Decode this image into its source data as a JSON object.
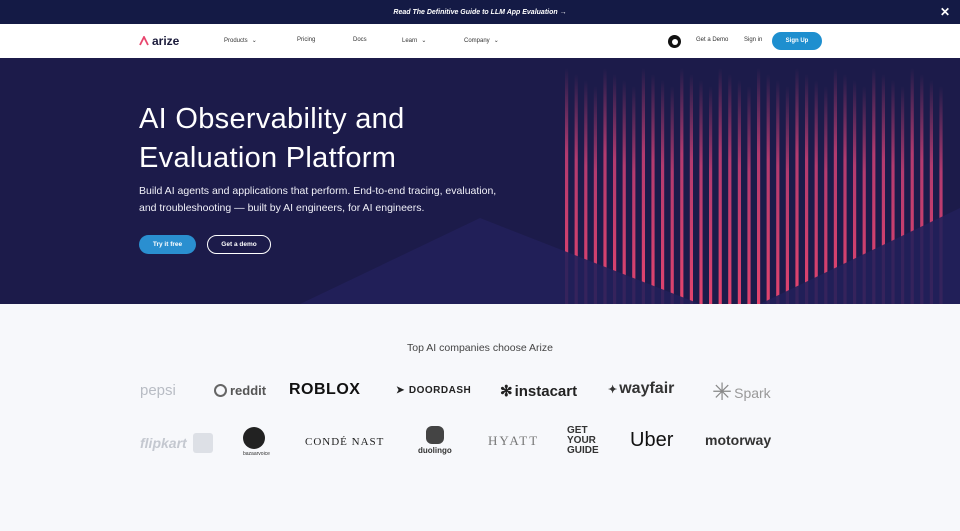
{
  "announcement": {
    "text": "Read The Definitive Guide to LLM App Evaluation →",
    "close": "✕"
  },
  "nav": {
    "brand": "arize",
    "links": [
      {
        "label": "Products",
        "has_menu": true
      },
      {
        "label": "Pricing",
        "has_menu": false
      },
      {
        "label": "Docs",
        "has_menu": false
      },
      {
        "label": "Learn",
        "has_menu": true
      },
      {
        "label": "Company",
        "has_menu": true
      }
    ],
    "github_icon": "github-icon",
    "get_demo": "Get a Demo",
    "sign_in": "Sign in",
    "sign_up": "Sign Up"
  },
  "hero": {
    "title_line1": "AI Observability and",
    "title_line2": "Evaluation Platform",
    "subtitle_line1": "Build AI agents and applications that perform. End-to-end tracing, evaluation,",
    "subtitle_line2": "and troubleshooting — built by AI engineers, for AI engineers.",
    "primary_cta": "Try it free",
    "secondary_cta": "Get a demo"
  },
  "customers": {
    "title": "Top AI companies choose Arize",
    "row1": [
      "pepsi",
      "reddit",
      "ROBLOX",
      "DOORDASH",
      "instacart",
      "wayfair",
      "Spark"
    ],
    "row2": [
      "flipkart",
      "bazaarvoice",
      "CONDÉ NAST",
      "duolingo",
      "HYATT",
      "GET YOUR GUIDE",
      "Uber",
      "motorway"
    ]
  },
  "colors": {
    "announce_bg": "#141a45",
    "hero_bg": "#1c1b4a",
    "accent": "#1e8fcf",
    "stripe": "#e8456d"
  }
}
